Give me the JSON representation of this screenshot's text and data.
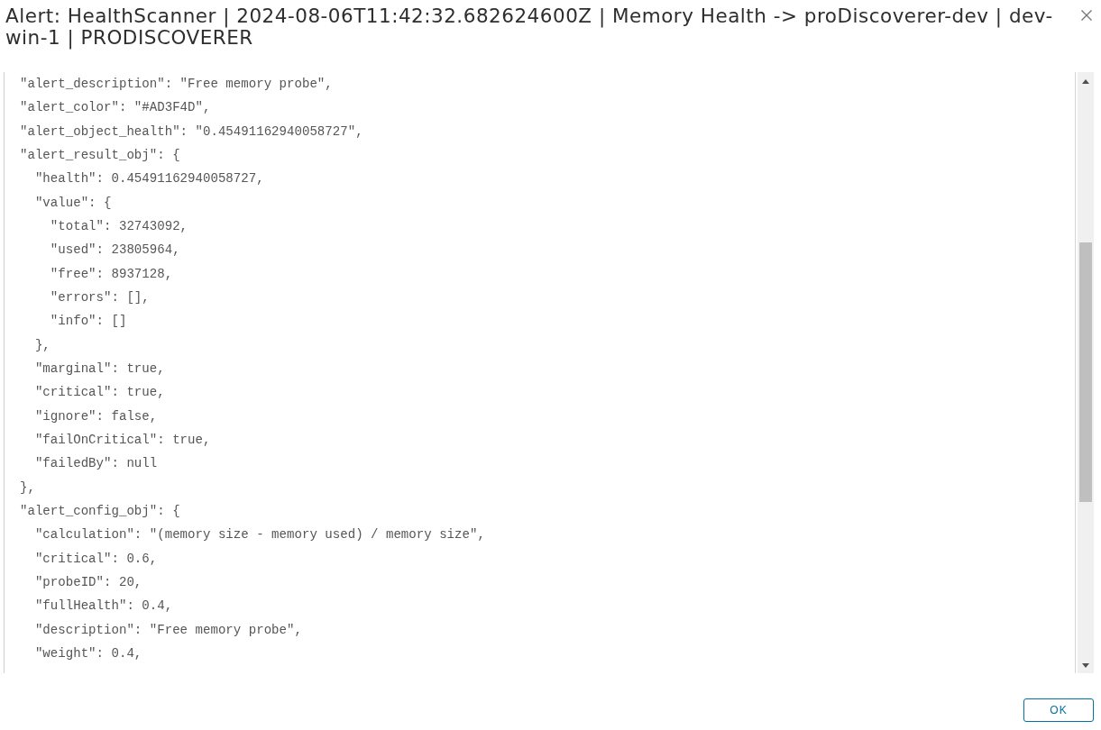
{
  "dialog": {
    "title": "Alert: HealthScanner | 2024-08-06T11:42:32.682624600Z | Memory Health -> proDiscoverer-dev | dev-win-1 | PRODISCOVERER"
  },
  "code_lines": [
    {
      "text": "\"alert_description\": \"Free memory probe\","
    },
    {
      "text": "\"alert_color\": \"#AD3F4D\","
    },
    {
      "text": "\"alert_object_health\": \"0.45491162940058727\","
    },
    {
      "text": "\"alert_result_obj\": {",
      "children": [
        {
          "text": "\"health\": 0.45491162940058727,"
        },
        {
          "text": "\"value\": {",
          "children": [
            {
              "text": "\"total\": 32743092,"
            },
            {
              "text": "\"used\": 23805964,"
            },
            {
              "text": "\"free\": 8937128,"
            },
            {
              "text": "\"errors\": [],"
            },
            {
              "text": "\"info\": []"
            }
          ]
        },
        {
          "text": "},"
        },
        {
          "text": "\"marginal\": true,"
        },
        {
          "text": "\"critical\": true,"
        },
        {
          "text": "\"ignore\": false,"
        },
        {
          "text": "\"failOnCritical\": true,"
        },
        {
          "text": "\"failedBy\": null"
        }
      ]
    },
    {
      "text": "},"
    },
    {
      "text": "\"alert_config_obj\": {",
      "children": [
        {
          "text": "\"calculation\": \"(memory size - memory used) / memory size\","
        },
        {
          "text": "\"critical\": 0.6,"
        },
        {
          "text": "\"probeID\": 20,"
        },
        {
          "text": "\"fullHealth\": 0.4,"
        },
        {
          "text": "\"description\": \"Free memory probe\","
        },
        {
          "text": "\"weight\": 0.4,"
        }
      ]
    }
  ],
  "buttons": [
    "OK"
  ]
}
